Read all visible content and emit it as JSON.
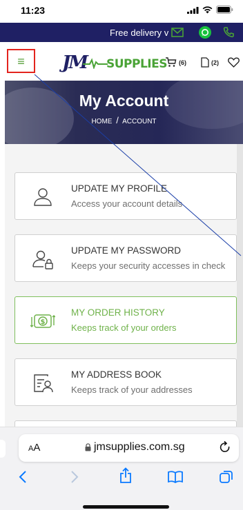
{
  "status_bar": {
    "time": "11:23"
  },
  "promo": {
    "text": "Free delivery v"
  },
  "header": {
    "logo_mark": "JM",
    "logo_text": "SUPPLIES",
    "cart_count": "(6)",
    "doc_count": "(2)"
  },
  "hero": {
    "title": "My Account",
    "breadcrumb_home": "HOME",
    "breadcrumb_sep": "/",
    "breadcrumb_current": "ACCOUNT"
  },
  "account_menu": [
    {
      "title": "UPDATE MY PROFILE",
      "subtitle": "Access your account details",
      "icon": "user-icon"
    },
    {
      "title": "UPDATE MY PASSWORD",
      "subtitle": "Keeps your security accesses in check",
      "icon": "user-lock-icon"
    },
    {
      "title": "MY ORDER HISTORY",
      "subtitle": "Keeps track of your orders",
      "icon": "money-cycle-icon"
    },
    {
      "title": "MY ADDRESS BOOK",
      "subtitle": "Keeps track of your addresses",
      "icon": "address-card-icon"
    }
  ],
  "safari": {
    "aa_small": "A",
    "aa_large": "A",
    "url": "jmsupplies.com.sg"
  },
  "colors": {
    "navy": "#1f2064",
    "green": "#4aa336",
    "active_green": "#6fb24a",
    "highlight_red": "#e3231d",
    "ios_blue": "#0a7aff"
  }
}
